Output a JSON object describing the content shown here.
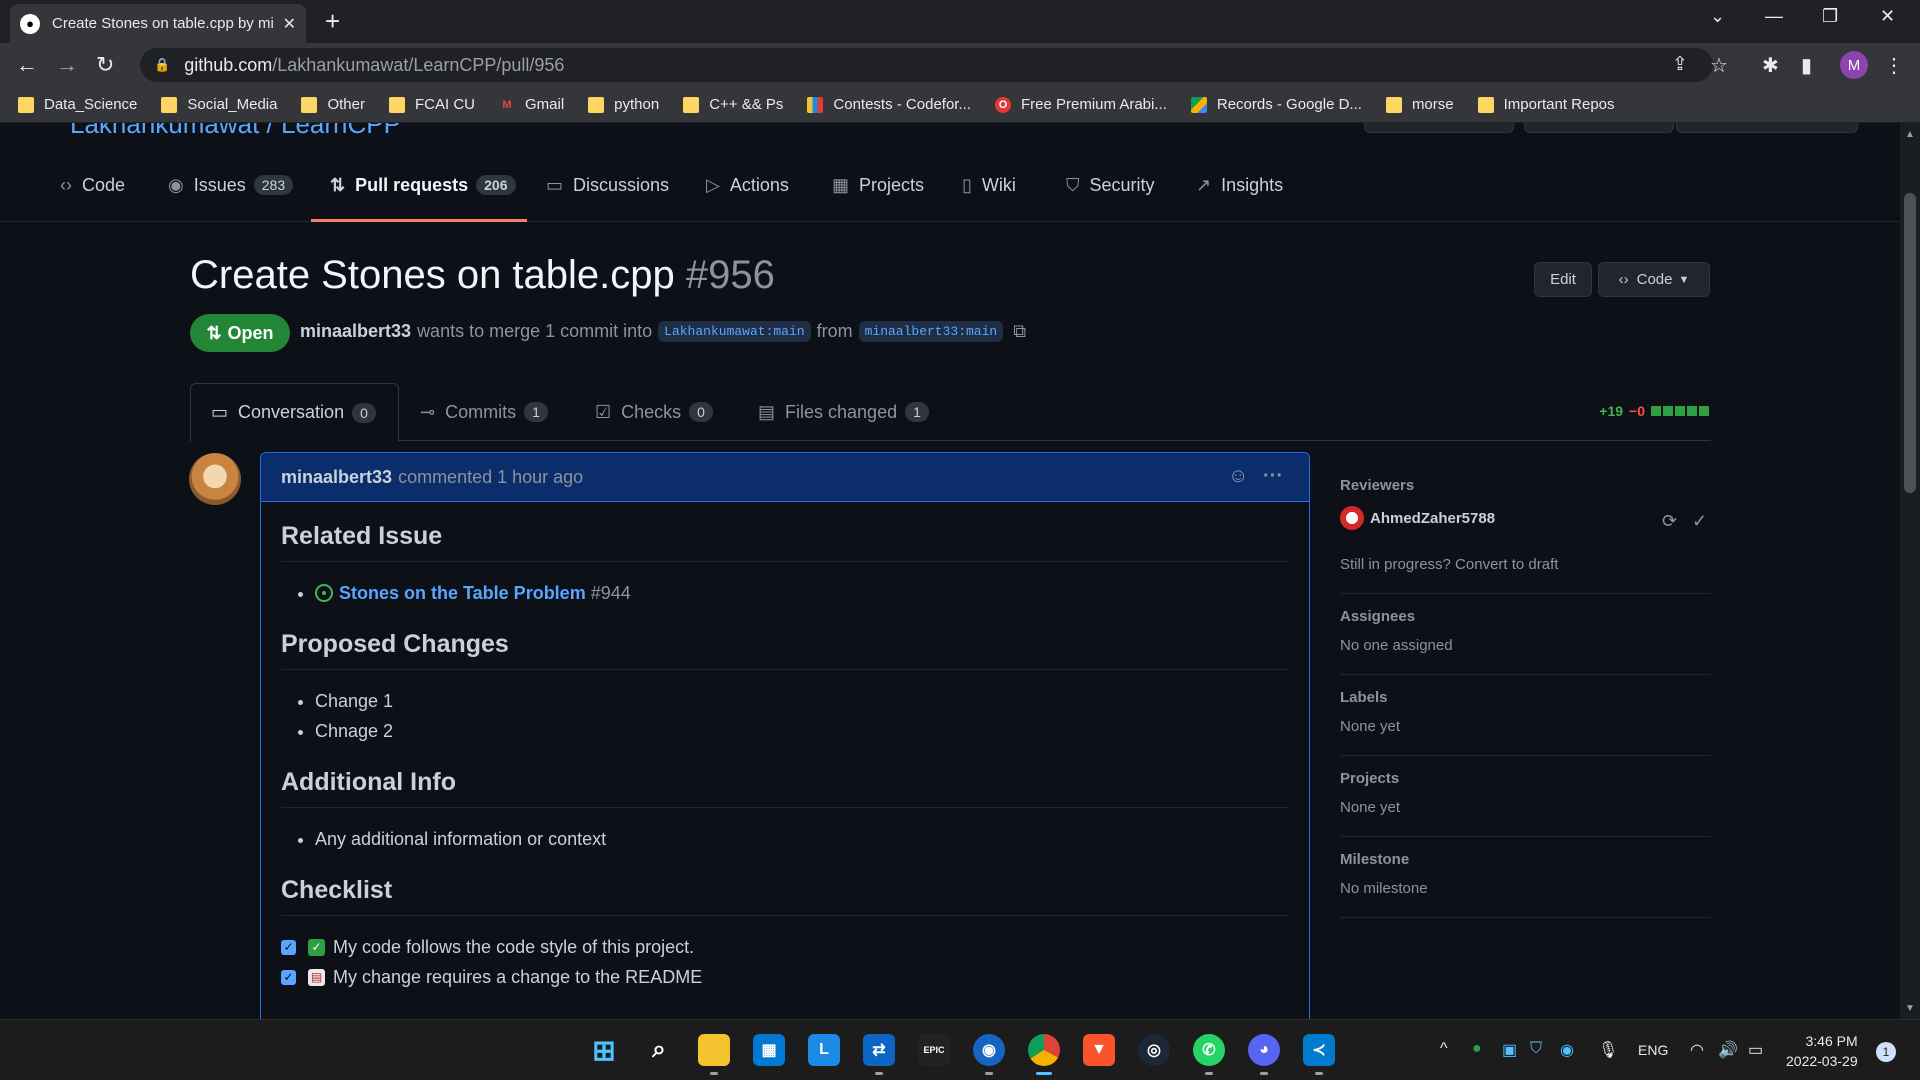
{
  "browser": {
    "tab_title": "Create Stones on table.cpp by mi",
    "url_host": "github.com",
    "url_path": "/Lakhankumawat/LearnCPP/pull/956",
    "profile_initial": "M",
    "bookmarks": [
      {
        "label": "Data_Science",
        "icon": "folder"
      },
      {
        "label": "Social_Media",
        "icon": "folder"
      },
      {
        "label": "Other",
        "icon": "folder"
      },
      {
        "label": "FCAI CU",
        "icon": "folder"
      },
      {
        "label": "Gmail",
        "icon": "gmail"
      },
      {
        "label": "python",
        "icon": "folder"
      },
      {
        "label": "C++ && Ps",
        "icon": "folder"
      },
      {
        "label": "Contests - Codefor...",
        "icon": "codeforces"
      },
      {
        "label": "Free Premium Arabi...",
        "icon": "opera"
      },
      {
        "label": "Records - Google D...",
        "icon": "drive"
      },
      {
        "label": "morse",
        "icon": "folder"
      },
      {
        "label": "Important Repos",
        "icon": "folder"
      }
    ]
  },
  "repo": {
    "breadcrumb_partial": "Lakhankumawat / LearnCPP",
    "tabs": [
      {
        "label": "Code",
        "icon": "code-icon"
      },
      {
        "label": "Issues",
        "icon": "issue-icon",
        "count": "283"
      },
      {
        "label": "Pull requests",
        "icon": "pull-request-icon",
        "count": "206"
      },
      {
        "label": "Discussions",
        "icon": "discussion-icon"
      },
      {
        "label": "Actions",
        "icon": "play-icon"
      },
      {
        "label": "Projects",
        "icon": "table-icon"
      },
      {
        "label": "Wiki",
        "icon": "book-icon"
      },
      {
        "label": "Security",
        "icon": "shield-icon"
      },
      {
        "label": "Insights",
        "icon": "graph-icon"
      }
    ]
  },
  "pr": {
    "title": "Create Stones on table.cpp",
    "number": "#956",
    "edit_label": "Edit",
    "code_label": "Code",
    "state": "Open",
    "author": "minaalbert33",
    "merge_text": "wants to merge 1 commit into",
    "base_branch": "Lakhankumawat:main",
    "from_text": "from",
    "head_branch": "minaalbert33:main",
    "tabs": [
      {
        "label": "Conversation",
        "count": "0"
      },
      {
        "label": "Commits",
        "count": "1"
      },
      {
        "label": "Checks",
        "count": "0"
      },
      {
        "label": "Files changed",
        "count": "1"
      }
    ],
    "additions": "+19",
    "deletions": "−0"
  },
  "comment": {
    "author": "minaalbert33",
    "action": "commented 1 hour ago",
    "sections": {
      "related_issue": "Related Issue",
      "issue_link": "Stones on the Table Problem",
      "issue_num": "#944",
      "proposed": "Proposed Changes",
      "change_1": "Change 1",
      "change_2": "Chnage 2",
      "additional": "Additional Info",
      "additional_item": "Any additional information or context",
      "checklist": "Checklist",
      "check_1": "My code follows the code style of this project.",
      "check_2": "My change requires a change to the README"
    }
  },
  "sidebar": {
    "reviewers_head": "Reviewers",
    "reviewer": "AhmedZaher5788",
    "draft_text": "Still in progress? Convert to draft",
    "assignees_head": "Assignees",
    "assignees_val": "No one assigned",
    "labels_head": "Labels",
    "labels_val": "None yet",
    "projects_head": "Projects",
    "projects_val": "None yet",
    "milestone_head": "Milestone",
    "milestone_val": "No milestone"
  },
  "taskbar": {
    "lang": "ENG",
    "time": "3:46 PM",
    "date": "2022-03-29",
    "notifications": "1"
  },
  "colors": {
    "accent_blue": "#58a6ff",
    "open_green": "#238636",
    "tab_underline": "#f78166"
  }
}
